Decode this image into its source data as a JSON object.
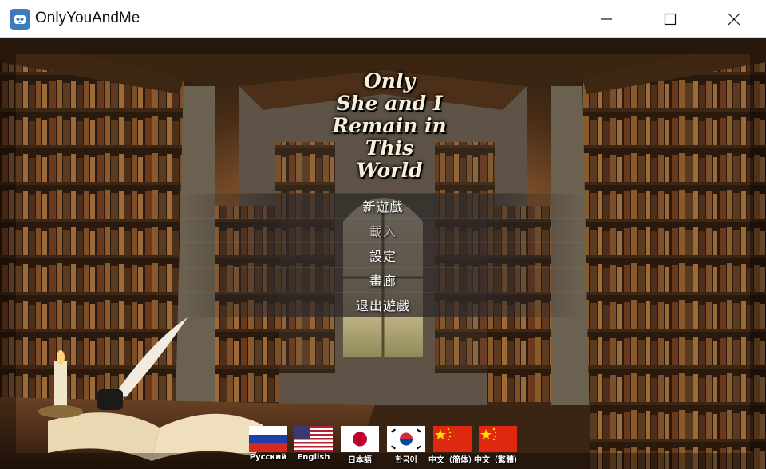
{
  "window": {
    "title": "OnlyYouAndMe",
    "icon": "godot-icon",
    "controls": [
      "minimize-icon",
      "maximize-icon",
      "close-icon"
    ]
  },
  "logo": {
    "lines": [
      "Only",
      "She and I",
      "Remain in",
      "This World"
    ]
  },
  "menu": {
    "items": [
      {
        "label": "新遊戲",
        "enabled": true
      },
      {
        "label": "載入",
        "enabled": false
      },
      {
        "label": "設定",
        "enabled": true
      },
      {
        "label": "畫廊",
        "enabled": true
      },
      {
        "label": "退出遊戲",
        "enabled": true
      }
    ]
  },
  "languages": [
    {
      "label": "Русский",
      "flag": "russia-flag-icon"
    },
    {
      "label": "English",
      "flag": "usa-flag-icon"
    },
    {
      "label": "日本語",
      "flag": "japan-flag-icon"
    },
    {
      "label": "한국어",
      "flag": "korea-flag-icon"
    },
    {
      "label": "中文（简体）",
      "flag": "china-flag-icon"
    },
    {
      "label": "中文（繁體）",
      "flag": "china-flag-icon"
    }
  ],
  "colors": {
    "title_bar": "#ffffff",
    "menu_text": "#ffffff",
    "menu_disabled_text": "#bdb6ac"
  }
}
